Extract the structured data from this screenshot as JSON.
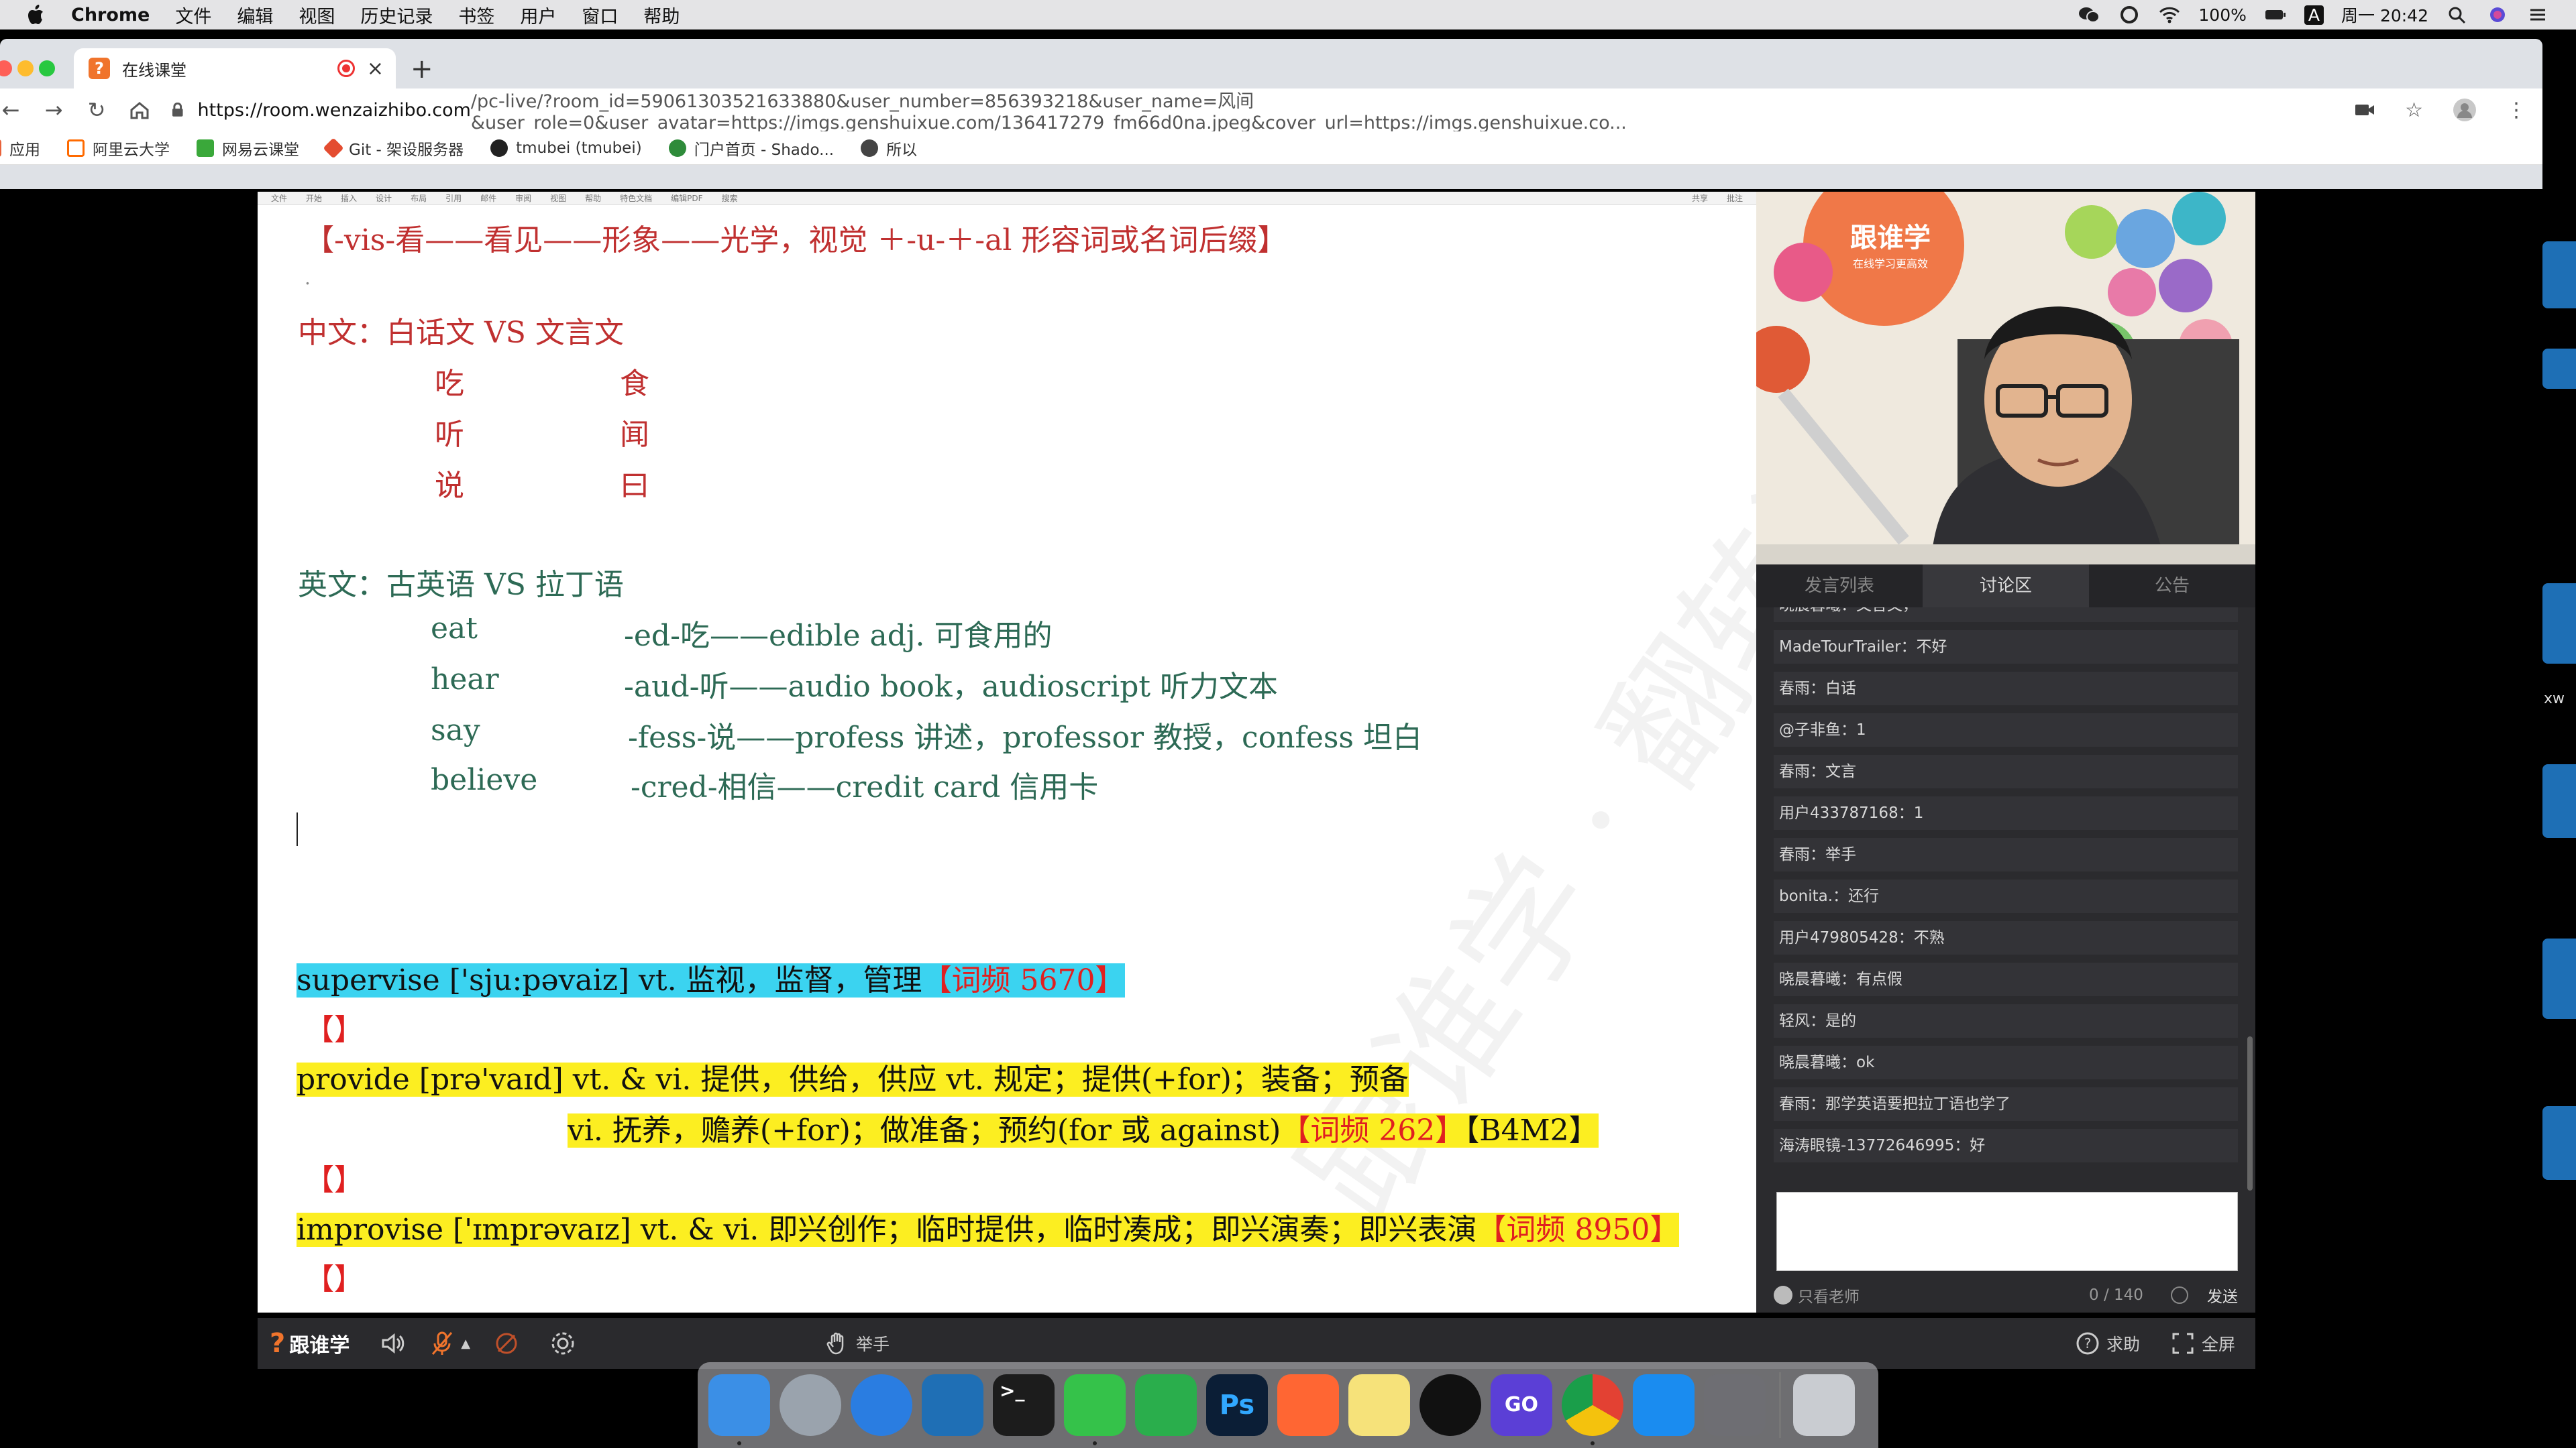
{
  "menubar": {
    "app": "Chrome",
    "items": [
      "文件",
      "编辑",
      "视图",
      "历史记录",
      "书签",
      "用户",
      "窗口",
      "帮助"
    ],
    "battery": "100%",
    "input_method": "A",
    "clock": "周一 20:42"
  },
  "browser": {
    "tab_title": "在线课堂",
    "url_host": "https://room.wenzaizhibo.com",
    "url_rest": "/pc-live/?room_id=59061303521633880&user_number=856393218&user_name=风间&user_role=0&user_avatar=https://imgs.genshuixue.com/136417279_fm66d0na.jpeg&cover_url=https://imgs.genshuixue.co...",
    "bookmarks": [
      {
        "label": "应用",
        "color": "#e8623a"
      },
      {
        "label": "阿里云大学",
        "color": "#ff6a00"
      },
      {
        "label": "网易云课堂",
        "color": "#3aa83a"
      },
      {
        "label": "Git - 架设服务器",
        "color": "#e44c30"
      },
      {
        "label": "tmubei (tmubei)",
        "color": "#222222"
      },
      {
        "label": "门户首页 - Shado...",
        "color": "#2e8b3a"
      },
      {
        "label": "所以",
        "color": "#444444"
      }
    ]
  },
  "document": {
    "ribbon": [
      "文件",
      "开始",
      "插入",
      "设计",
      "布局",
      "引用",
      "邮件",
      "审阅",
      "视图",
      "帮助",
      "特色文档",
      "编辑PDF",
      "搜索"
    ],
    "ribbon_right": [
      "共享",
      "批注"
    ],
    "line_vis": "【-vis-看——看见——形象——光学，视觉 ＋-u-＋-al 形容词或名词后缀】",
    "chinese_title": "中文：白话文  VS  文言文",
    "chinese_pairs": [
      [
        "吃",
        "食"
      ],
      [
        "听",
        "闻"
      ],
      [
        "说",
        "曰"
      ]
    ],
    "english_title": "英文：古英语  VS  拉丁语",
    "english_rows": [
      {
        "word": "eat",
        "root": "-ed-吃——edible adj. 可食用的"
      },
      {
        "word": "hear",
        "root": "-aud-听——audio book，audioscript 听力文本"
      },
      {
        "word": "say",
        "root": "-fess-说——profess 讲述，professor 教授，confess 坦白"
      },
      {
        "word": "believe",
        "root": "-cred-相信——credit card 信用卡"
      }
    ],
    "supervise": {
      "text": "supervise ['sju:pəvaiz] vt. 监视，监督，管理",
      "freq": "【词频 5670】"
    },
    "bracket": "【】",
    "provide": {
      "text": "provide [prə'vaɪd] vt. & vi. 提供，供给，供应 vt. 规定；提供(+for)；装备；预备"
    },
    "provide2": {
      "text": "vi. 抚养，赡养(+for)；做准备；预约(for 或 against)",
      "freq": "【词频 262】",
      "tag": "【B4M2】"
    },
    "improvise": {
      "text": "improvise ['ɪmprəvaɪz] vt. & vi. 即兴创作；临时提供，临时凑成；即兴演奏；即兴表演",
      "freq": "【词频 8950】"
    },
    "watermark": "跟谁学 · 翻转课堂"
  },
  "panel": {
    "tabs": [
      "发言列表",
      "讨论区",
      "公告"
    ],
    "active_tab": "讨论区",
    "messages": [
      "晓晨暮曦：文言文，",
      "MadeTourTrailer：不好",
      "春雨：白话",
      "@子非鱼：1",
      "春雨：文言",
      "用户433787168：1",
      "春雨：举手",
      "bonita.：还行",
      "用户479805428：不熟",
      "晓晨暮曦：有点假",
      "轻风：是的",
      "晓晨暮曦：ok",
      "春雨：那学英语要把拉丁语也学了",
      "海涛眼镜-13772646995：好"
    ],
    "teacher_only": "只看老师",
    "counter": "0 / 140",
    "send": "发送",
    "video_logo": "跟谁学",
    "video_logo_sub": "在线学习更高效"
  },
  "classbar": {
    "logo": "跟谁学",
    "raise_hand": "举手",
    "help": "求助",
    "fullscreen": "全屏"
  },
  "desktop": {
    "edge_text": "xw",
    "dock": [
      {
        "name": "finder",
        "color": "#3b8fe6",
        "label": ""
      },
      {
        "name": "launchpad",
        "color": "#9aa3ad",
        "label": ""
      },
      {
        "name": "safari",
        "color": "#2a7de1",
        "label": ""
      },
      {
        "name": "vscode",
        "color": "#1f6fb5",
        "label": ""
      },
      {
        "name": "terminal",
        "color": "#1c1c1c",
        "label": ""
      },
      {
        "name": "wechat",
        "color": "#35c24a",
        "label": ""
      },
      {
        "name": "evernote",
        "color": "#2aae4c",
        "label": ""
      },
      {
        "name": "photoshop",
        "color": "#0b1e36",
        "label": "Ps"
      },
      {
        "name": "cloud",
        "color": "#ff6633",
        "label": ""
      },
      {
        "name": "stickies",
        "color": "#f6e27a",
        "label": ""
      },
      {
        "name": "qq",
        "color": "#111111",
        "label": ""
      },
      {
        "name": "goland",
        "color": "#5b3fd6",
        "label": "GO"
      },
      {
        "name": "chrome",
        "color": "#e34133",
        "label": ""
      },
      {
        "name": "app-store",
        "color": "#1a8cf0",
        "label": ""
      },
      {
        "name": "system-preferences",
        "color": "#6e6e73",
        "label": ""
      },
      {
        "name": "trash",
        "color": "#c9ccd1",
        "label": ""
      }
    ]
  }
}
